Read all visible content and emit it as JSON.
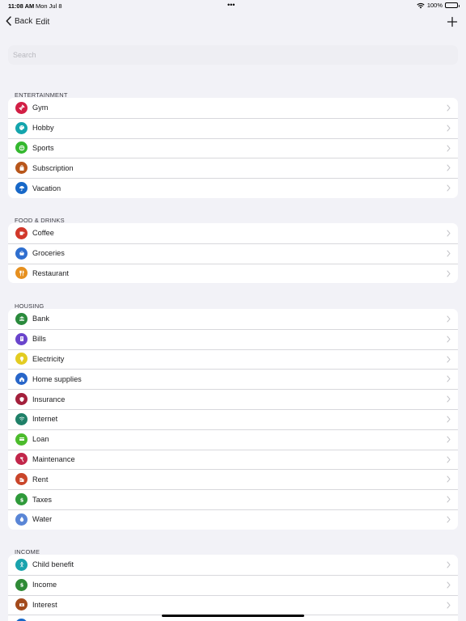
{
  "status": {
    "time": "11:08 AM",
    "date": "Mon Jul 8",
    "battery": "100%"
  },
  "nav": {
    "back_label": "Back",
    "edit_label": "Edit"
  },
  "search": {
    "placeholder": "Search"
  },
  "sections": [
    {
      "title": "ENTERTAINMENT",
      "items": [
        {
          "label": "Gym",
          "color": "#d21f45",
          "icon": "dumbbell-icon"
        },
        {
          "label": "Hobby",
          "color": "#14a5ad",
          "icon": "palette-icon"
        },
        {
          "label": "Sports",
          "color": "#34b82e",
          "icon": "ball-icon"
        },
        {
          "label": "Subscription",
          "color": "#b8561a",
          "icon": "bag-icon"
        },
        {
          "label": "Vacation",
          "color": "#1768c8",
          "icon": "umbrella-icon"
        }
      ]
    },
    {
      "title": "FOOD & DRINKS",
      "items": [
        {
          "label": "Coffee",
          "color": "#d1382a",
          "icon": "cup-icon"
        },
        {
          "label": "Groceries",
          "color": "#2f6fcf",
          "icon": "basket-icon"
        },
        {
          "label": "Restaurant",
          "color": "#e6901f",
          "icon": "cutlery-icon"
        }
      ]
    },
    {
      "title": "HOUSING",
      "items": [
        {
          "label": "Bank",
          "color": "#2a8a3c",
          "icon": "bank-icon"
        },
        {
          "label": "Bills",
          "color": "#6a45cc",
          "icon": "document-icon"
        },
        {
          "label": "Electricity",
          "color": "#e3cc22",
          "icon": "bulb-icon"
        },
        {
          "label": "Home supplies",
          "color": "#2866c9",
          "icon": "house-icon"
        },
        {
          "label": "Insurance",
          "color": "#a3203c",
          "icon": "shield-icon"
        },
        {
          "label": "Internet",
          "color": "#1f8068",
          "icon": "wifi-icon"
        },
        {
          "label": "Loan",
          "color": "#4cbc2c",
          "icon": "card-icon"
        },
        {
          "label": "Maintenance",
          "color": "#c2264a",
          "icon": "hammer-icon"
        },
        {
          "label": "Rent",
          "color": "#c9452a",
          "icon": "building-icon"
        },
        {
          "label": "Taxes",
          "color": "#2f9a3a",
          "icon": "dollar-icon"
        },
        {
          "label": "Water",
          "color": "#5a86d6",
          "icon": "drop-icon"
        }
      ]
    },
    {
      "title": "INCOME",
      "items": [
        {
          "label": "Child benefit",
          "color": "#1aa3ad",
          "icon": "child-icon"
        },
        {
          "label": "Income",
          "color": "#2f8a36",
          "icon": "dollar-icon"
        },
        {
          "label": "Interest",
          "color": "#a34a1c",
          "icon": "cash-icon"
        },
        {
          "label": "",
          "color": "#1768c8",
          "icon": "circle-icon"
        }
      ]
    }
  ]
}
